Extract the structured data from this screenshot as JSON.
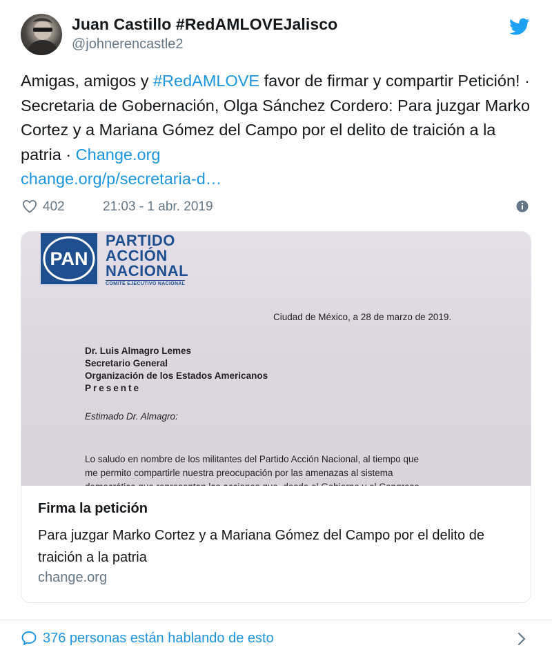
{
  "author": {
    "display_name": "Juan Castillo #RedAMLOVEJalisco",
    "handle": "@johnerencastle2"
  },
  "tweet": {
    "text_part1": "Amigas, amigos y ",
    "hashtag": "#RedAMLOVE",
    "text_part2": " favor de firmar y compartir Petición! · Secretaria de Gobernación, Olga Sánchez Cordero: Para juzgar Marko Cortez y a Mariana Gómez del Campo por el delito de traición a la patria · ",
    "link_site": "Change.org",
    "link_url": "change.org/p/secretaria-d…"
  },
  "meta": {
    "likes": "402",
    "timestamp": "21:03 - 1 abr. 2019"
  },
  "card": {
    "image": {
      "logo_lines": [
        "PARTIDO",
        "ACCIÓN",
        "NACIONAL"
      ],
      "logo_sub": "COMITÉ EJECUTIVO NACIONAL",
      "logo_mark": "PAN",
      "date_line": "Ciudad de México, a 28 de marzo de 2019.",
      "address": [
        "Dr. Luis Almagro Lemes",
        "Secretario General",
        "Organización de los Estados Americanos",
        "Presente"
      ],
      "greeting": "Estimado Dr. Almagro:",
      "body_lines": [
        "Lo saludo en nombre de los militantes del Partido Acción Nacional, al tiempo que",
        "me permito compartirle nuestra preocupación por las amenazas al sistema",
        "democrático que representan las acciones que, desde el Gobierno y el Congreso"
      ]
    },
    "title": "Firma la petición",
    "description": "Para juzgar Marko Cortez y a Mariana Gómez del Campo por el delito de traición a la patria",
    "domain": "change.org"
  },
  "footer": {
    "conversation": "376 personas están hablando de esto"
  },
  "icons": {
    "twitter_bird": "twitter-bird-icon",
    "heart": "heart-icon",
    "info": "info-icon",
    "reply_bubble": "reply-bubble-icon",
    "chevron": "chevron-right-icon"
  },
  "colors": {
    "link": "#1b95e0",
    "muted": "#657786",
    "border": "#e1e8ed",
    "text": "#14171a",
    "pan_blue": "#1f4f8f"
  }
}
